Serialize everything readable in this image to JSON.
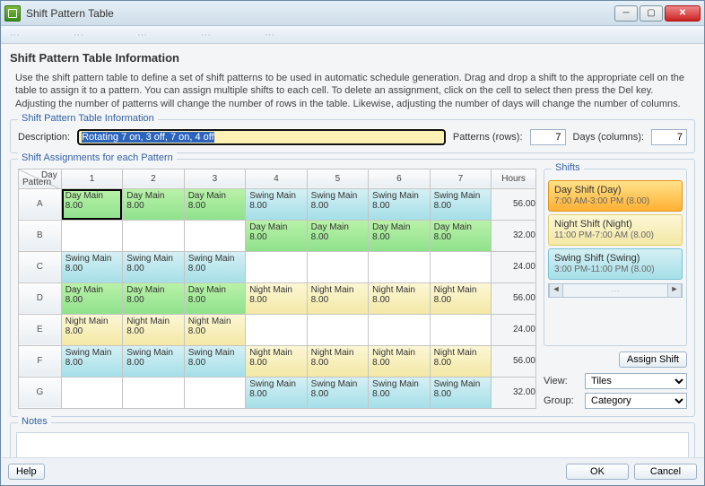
{
  "window": {
    "title": "Shift Pattern Table"
  },
  "header": {
    "title": "Shift Pattern Table Information",
    "help": "Use the shift pattern table to define a set of shift patterns to be used in automatic schedule generation. Drag and drop a shift to the appropriate cell on the table to assign it to a pattern. You can assign multiple shifts to each cell. To delete an assignment, click on the cell to select then press the Del key.  Adjusting the number of patterns will change the number of rows in the table. Likewise, adjusting the number of days will change the number of columns."
  },
  "info": {
    "legend": "Shift Pattern Table Information",
    "description_label": "Description:",
    "description_value": "Rotating 7 on, 3 off, 7 on, 4 off",
    "patterns_label": "Patterns (rows):",
    "patterns_value": "7",
    "days_label": "Days (columns):",
    "days_value": "7"
  },
  "assign": {
    "legend": "Shift Assignments for each Pattern",
    "corner_day": "Day",
    "corner_pattern": "Pattern",
    "day_headers": [
      "1",
      "2",
      "3",
      "4",
      "5",
      "6",
      "7"
    ],
    "hours_header": "Hours",
    "pattern_labels": [
      "A",
      "B",
      "C",
      "D",
      "E",
      "F",
      "G"
    ],
    "cells": [
      [
        {
          "t": "day",
          "n": "Day Main",
          "v": "8.00",
          "sel": true
        },
        {
          "t": "day",
          "n": "Day Main",
          "v": "8.00"
        },
        {
          "t": "day",
          "n": "Day Main",
          "v": "8.00"
        },
        {
          "t": "swing",
          "n": "Swing Main",
          "v": "8.00"
        },
        {
          "t": "swing",
          "n": "Swing Main",
          "v": "8.00"
        },
        {
          "t": "swing",
          "n": "Swing Main",
          "v": "8.00"
        },
        {
          "t": "swing",
          "n": "Swing Main",
          "v": "8.00"
        }
      ],
      [
        {
          "t": "empty"
        },
        {
          "t": "empty"
        },
        {
          "t": "empty"
        },
        {
          "t": "day",
          "n": "Day Main",
          "v": "8.00"
        },
        {
          "t": "day",
          "n": "Day Main",
          "v": "8.00"
        },
        {
          "t": "day",
          "n": "Day Main",
          "v": "8.00"
        },
        {
          "t": "day",
          "n": "Day Main",
          "v": "8.00"
        }
      ],
      [
        {
          "t": "swing",
          "n": "Swing Main",
          "v": "8.00"
        },
        {
          "t": "swing",
          "n": "Swing Main",
          "v": "8.00"
        },
        {
          "t": "swing",
          "n": "Swing Main",
          "v": "8.00"
        },
        {
          "t": "empty"
        },
        {
          "t": "empty"
        },
        {
          "t": "empty"
        },
        {
          "t": "empty"
        }
      ],
      [
        {
          "t": "day",
          "n": "Day Main",
          "v": "8.00"
        },
        {
          "t": "day",
          "n": "Day Main",
          "v": "8.00"
        },
        {
          "t": "day",
          "n": "Day Main",
          "v": "8.00"
        },
        {
          "t": "night",
          "n": "Night Main",
          "v": "8.00"
        },
        {
          "t": "night",
          "n": "Night Main",
          "v": "8.00"
        },
        {
          "t": "night",
          "n": "Night Main",
          "v": "8.00"
        },
        {
          "t": "night",
          "n": "Night Main",
          "v": "8.00"
        }
      ],
      [
        {
          "t": "night",
          "n": "Night Main",
          "v": "8.00"
        },
        {
          "t": "night",
          "n": "Night Main",
          "v": "8.00"
        },
        {
          "t": "night",
          "n": "Night Main",
          "v": "8.00"
        },
        {
          "t": "empty"
        },
        {
          "t": "empty"
        },
        {
          "t": "empty"
        },
        {
          "t": "empty"
        }
      ],
      [
        {
          "t": "swing",
          "n": "Swing Main",
          "v": "8.00"
        },
        {
          "t": "swing",
          "n": "Swing Main",
          "v": "8.00"
        },
        {
          "t": "swing",
          "n": "Swing Main",
          "v": "8.00"
        },
        {
          "t": "night",
          "n": "Night Main",
          "v": "8.00"
        },
        {
          "t": "night",
          "n": "Night Main",
          "v": "8.00"
        },
        {
          "t": "night",
          "n": "Night Main",
          "v": "8.00"
        },
        {
          "t": "night",
          "n": "Night Main",
          "v": "8.00"
        }
      ],
      [
        {
          "t": "empty"
        },
        {
          "t": "empty"
        },
        {
          "t": "empty"
        },
        {
          "t": "swing",
          "n": "Swing Main",
          "v": "8.00"
        },
        {
          "t": "swing",
          "n": "Swing Main",
          "v": "8.00"
        },
        {
          "t": "swing",
          "n": "Swing Main",
          "v": "8.00"
        },
        {
          "t": "swing",
          "n": "Swing Main",
          "v": "8.00"
        }
      ]
    ],
    "hours": [
      "56.00",
      "32.00",
      "24.00",
      "56.00",
      "24.00",
      "56.00",
      "32.00"
    ]
  },
  "shifts": {
    "legend": "Shifts",
    "items": [
      {
        "type": "day",
        "name": "Day Shift (Day)",
        "detail": "7:00 AM-3:00 PM (8.00)"
      },
      {
        "type": "night",
        "name": "Night Shift (Night)",
        "detail": "11:00 PM-7:00 AM (8.00)"
      },
      {
        "type": "swing",
        "name": "Swing Shift (Swing)",
        "detail": "3:00 PM-11:00 PM (8.00)"
      }
    ],
    "assign_btn": "Assign Shift",
    "view_label": "View:",
    "view_value": "Tiles",
    "group_label": "Group:",
    "group_value": "Category"
  },
  "notes": {
    "legend": "Notes",
    "value": ""
  },
  "footer": {
    "help": "Help",
    "ok": "OK",
    "cancel": "Cancel"
  }
}
